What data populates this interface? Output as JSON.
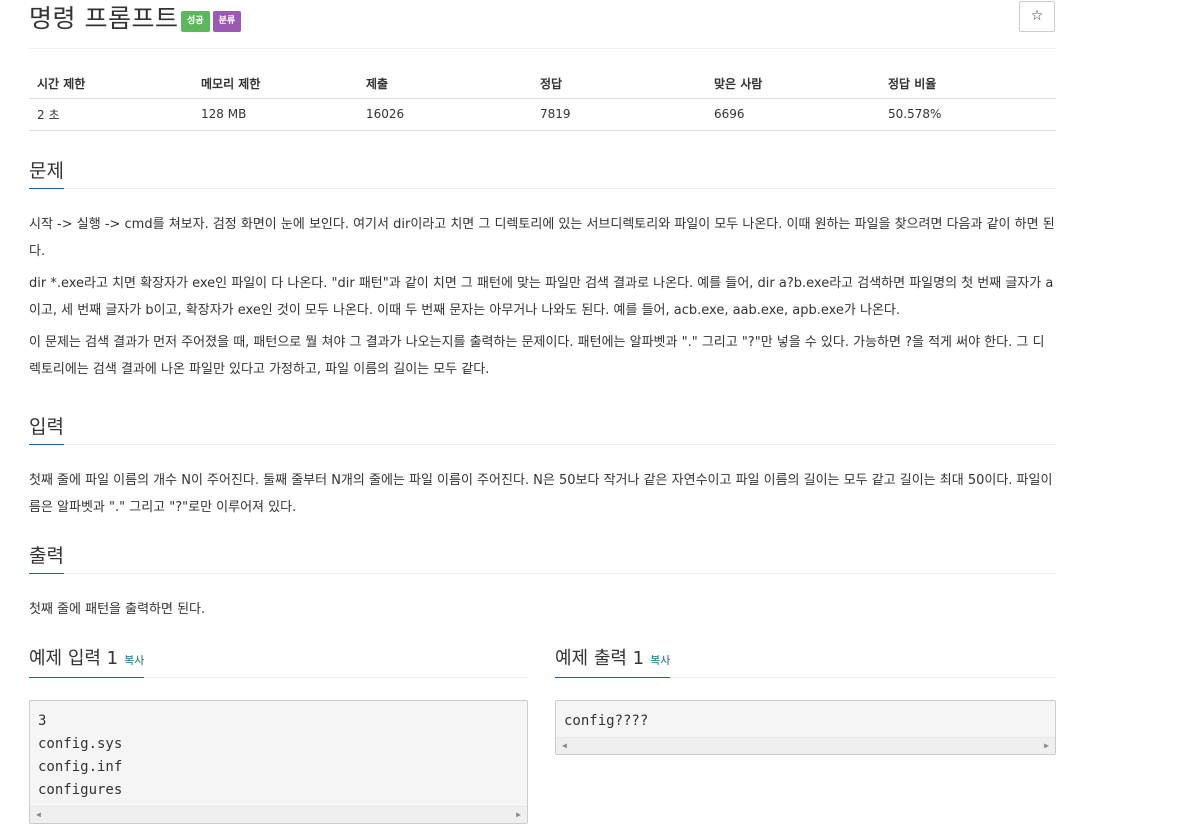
{
  "problem": {
    "title": "명령 프롬프트",
    "badges": {
      "success": "성공",
      "tag": "분류"
    },
    "star_icon": "☆"
  },
  "info": {
    "headers": [
      "시간 제한",
      "메모리 제한",
      "제출",
      "정답",
      "맞은 사람",
      "정답 비율"
    ],
    "values": [
      "2 초",
      "128 MB",
      "16026",
      "7819",
      "6696",
      "50.578%"
    ]
  },
  "sections": {
    "description": {
      "title": "문제",
      "paragraphs": [
        "시작 -> 실행 -> cmd를 쳐보자. 검정 화면이 눈에 보인다. 여기서 dir이라고 치면 그 디렉토리에 있는 서브디렉토리와 파일이 모두 나온다. 이때 원하는 파일을 찾으려면 다음과 같이 하면 된다.",
        "dir *.exe라고 치면 확장자가 exe인 파일이 다 나온다. \"dir 패턴\"과 같이 치면 그 패턴에 맞는 파일만 검색 결과로 나온다. 예를 들어, dir a?b.exe라고 검색하면 파일명의 첫 번째 글자가 a이고, 세 번째 글자가 b이고, 확장자가 exe인 것이 모두 나온다. 이때 두 번째 문자는 아무거나 나와도 된다. 예를 들어, acb.exe, aab.exe, apb.exe가 나온다.",
        "이 문제는 검색 결과가 먼저 주어졌을 때, 패턴으로 뭘 쳐야 그 결과가 나오는지를 출력하는 문제이다. 패턴에는 알파벳과 \".\" 그리고 \"?\"만 넣을 수 있다. 가능하면 ?을 적게 써야 한다. 그 디렉토리에는 검색 결과에 나온 파일만 있다고 가정하고, 파일 이름의 길이는 모두 같다."
      ]
    },
    "input": {
      "title": "입력",
      "paragraphs": [
        "첫째 줄에 파일 이름의 개수 N이 주어진다. 둘째 줄부터 N개의 줄에는 파일 이름이 주어진다. N은 50보다 작거나 같은 자연수이고 파일 이름의 길이는 모두 같고 길이는 최대 50이다. 파일이름은 알파벳과 \".\" 그리고 \"?\"로만 이루어져 있다."
      ]
    },
    "output": {
      "title": "출력",
      "paragraphs": [
        "첫째 줄에 패턴을 출력하면 된다."
      ]
    }
  },
  "examples": {
    "copy_label": "복사",
    "sample_input": {
      "title": "예제 입력 1",
      "lines": [
        "3",
        "config.sys",
        "config.inf",
        "configures"
      ]
    },
    "sample_output": {
      "title": "예제 출력 1",
      "lines": [
        "config????"
      ]
    }
  },
  "scroll_left_icon": "◀",
  "scroll_right_icon": "▶"
}
